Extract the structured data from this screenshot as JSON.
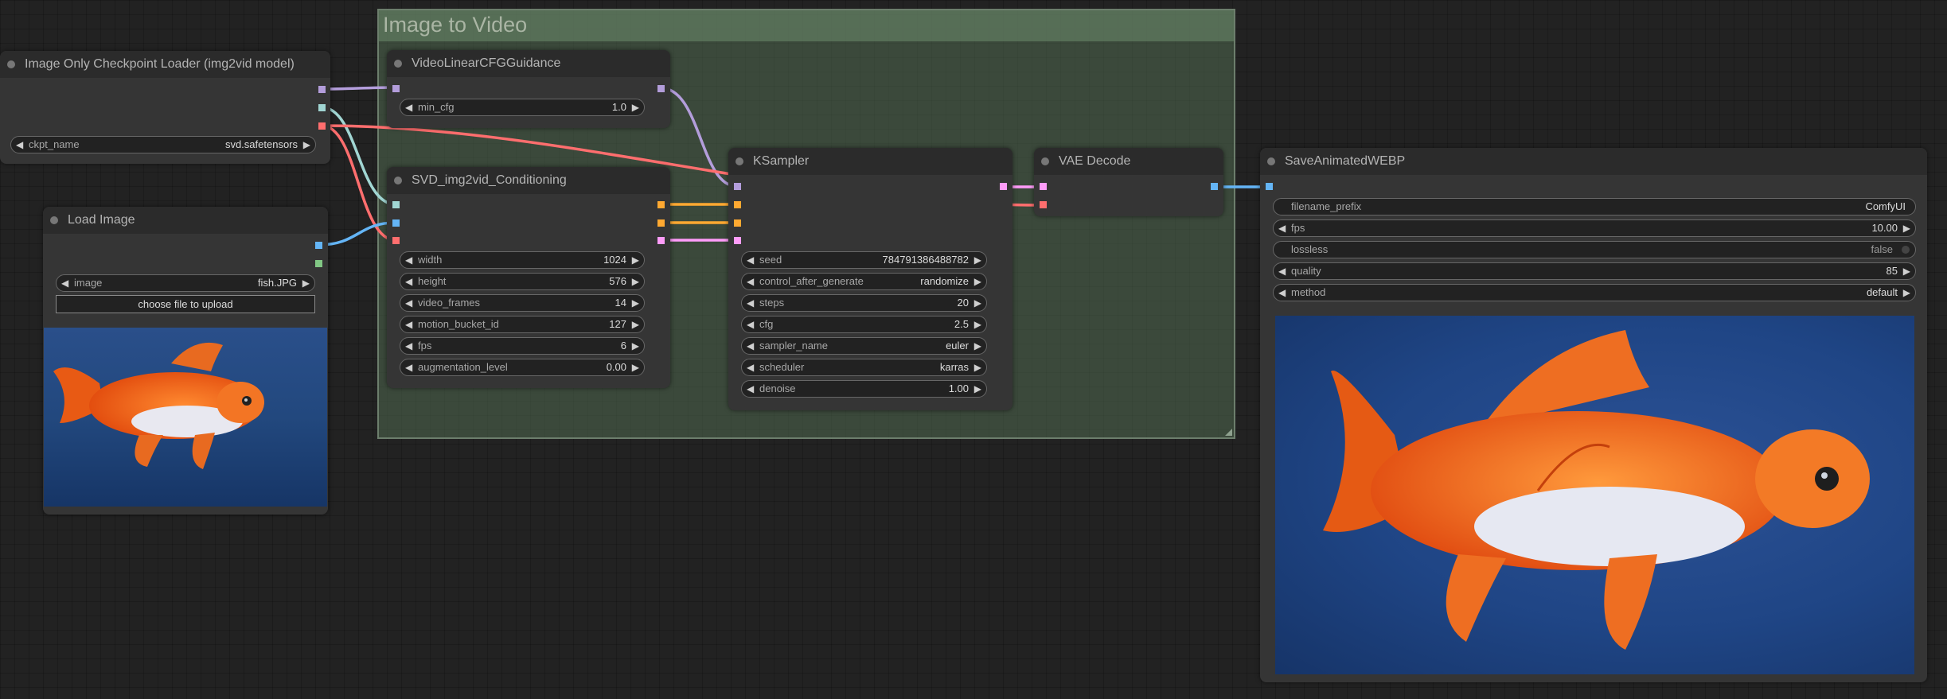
{
  "group": {
    "title": "Image to Video"
  },
  "nodes": {
    "checkpoint_loader": {
      "title": "Image Only Checkpoint Loader (img2vid model)",
      "widgets": [
        {
          "name": "ckpt_name",
          "value": "svd.safetensors"
        }
      ]
    },
    "load_image": {
      "title": "Load Image",
      "widgets": [
        {
          "name": "image",
          "value": "fish.JPG"
        }
      ],
      "upload_label": "choose file to upload"
    },
    "video_cfg": {
      "title": "VideoLinearCFGGuidance",
      "widgets": [
        {
          "name": "min_cfg",
          "value": "1.0"
        }
      ]
    },
    "svd_conditioning": {
      "title": "SVD_img2vid_Conditioning",
      "widgets": [
        {
          "name": "width",
          "value": "1024"
        },
        {
          "name": "height",
          "value": "576"
        },
        {
          "name": "video_frames",
          "value": "14"
        },
        {
          "name": "motion_bucket_id",
          "value": "127"
        },
        {
          "name": "fps",
          "value": "6"
        },
        {
          "name": "augmentation_level",
          "value": "0.00"
        }
      ]
    },
    "ksampler": {
      "title": "KSampler",
      "widgets": [
        {
          "name": "seed",
          "value": "784791386488782"
        },
        {
          "name": "control_after_generate",
          "value": "randomize"
        },
        {
          "name": "steps",
          "value": "20"
        },
        {
          "name": "cfg",
          "value": "2.5"
        },
        {
          "name": "sampler_name",
          "value": "euler"
        },
        {
          "name": "scheduler",
          "value": "karras"
        },
        {
          "name": "denoise",
          "value": "1.00"
        }
      ]
    },
    "vae_decode": {
      "title": "VAE Decode"
    },
    "save_webp": {
      "title": "SaveAnimatedWEBP",
      "widgets": [
        {
          "name": "filename_prefix",
          "value": "ComfyUI"
        },
        {
          "name": "fps",
          "value": "10.00"
        },
        {
          "name": "lossless",
          "value": "false"
        },
        {
          "name": "quality",
          "value": "85"
        },
        {
          "name": "method",
          "value": "default"
        }
      ]
    }
  },
  "arrows": {
    "left": "◀",
    "right": "▶"
  },
  "colors": {
    "model_link": "#b39ddb",
    "clip_vision_link": "#a1d6d3",
    "vae_link": "#ff6e6e",
    "image_link": "#64b5f6",
    "conditioning_link": "#ffa931",
    "latent_link": "#ff9cf9",
    "mask_slot": "#81c784"
  }
}
